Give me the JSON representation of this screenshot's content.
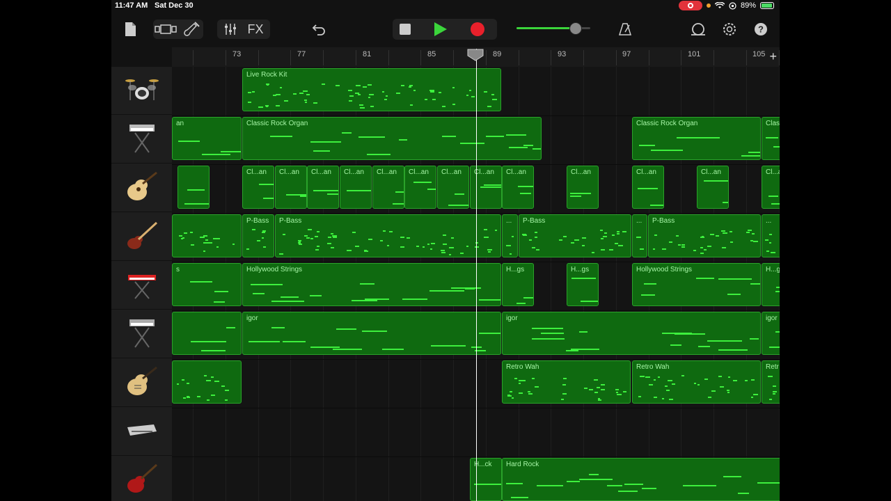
{
  "status_bar": {
    "time": "11:47 AM",
    "date": "Sat Dec 30",
    "battery": "89%"
  },
  "toolbar": {
    "fx_label": "FX"
  },
  "transport": {
    "volume_level": 0.8
  },
  "ruler": {
    "bars": [
      "73",
      "77",
      "81",
      "85",
      "89",
      "93",
      "97",
      "101",
      "105"
    ],
    "add_symbol": "+"
  },
  "tracks": [
    {
      "icon": "drum-kit-icon",
      "regions": [
        {
          "label": "Live Rock Kit"
        }
      ]
    },
    {
      "icon": "organ-keyboard-icon",
      "regions": [
        {
          "label": "an"
        },
        {
          "label": "Classic Rock Organ"
        },
        {
          "label": "Classic Rock Organ"
        },
        {
          "label": "Clas"
        }
      ]
    },
    {
      "icon": "acoustic-guitar-icon",
      "regions": [
        {
          "label": "Cl...an"
        }
      ]
    },
    {
      "icon": "bass-guitar-icon",
      "regions": [
        {
          "label": "P-Bass"
        },
        {
          "label": "P-Bass"
        },
        {
          "label": "..."
        },
        {
          "label": "P-Bass"
        },
        {
          "label": "..."
        },
        {
          "label": "P-Bass"
        },
        {
          "label": "..."
        }
      ]
    },
    {
      "icon": "red-keyboard-icon",
      "regions": [
        {
          "label": "s"
        },
        {
          "label": "Hollywood Strings"
        },
        {
          "label": "H...gs"
        },
        {
          "label": "H...gs"
        },
        {
          "label": "Hollywood Strings"
        },
        {
          "label": "H...g"
        }
      ]
    },
    {
      "icon": "synth-keyboard-icon",
      "regions": [
        {
          "label": "igor"
        },
        {
          "label": "igor"
        },
        {
          "label": "igor"
        }
      ]
    },
    {
      "icon": "electric-guitar-icon",
      "regions": [
        {
          "label": "Retro Wah"
        },
        {
          "label": "Retro Wah"
        },
        {
          "label": "Retr"
        }
      ]
    },
    {
      "icon": "drum-machine-icon",
      "regions": []
    },
    {
      "icon": "red-electric-guitar-icon",
      "regions": [
        {
          "label": "H...ck"
        },
        {
          "label": "Hard Rock"
        }
      ]
    }
  ]
}
